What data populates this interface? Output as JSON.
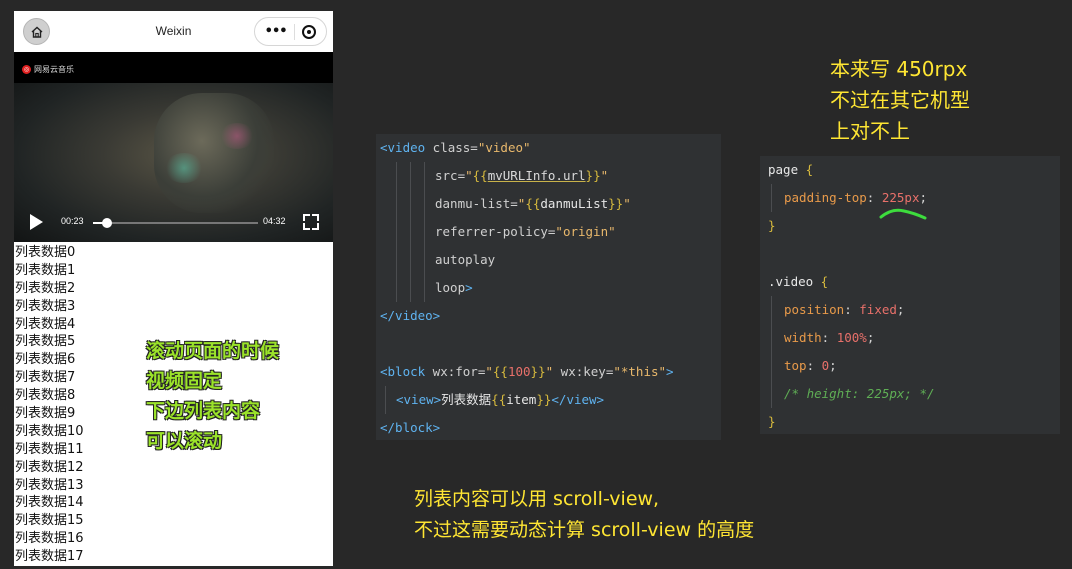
{
  "phone": {
    "nav_title": "Weixin",
    "capsule_menu": "•••",
    "video": {
      "brand": "网易云音乐",
      "current_time": "00:23",
      "total_time": "04:32",
      "progress_fraction": 0.085
    },
    "list_items": [
      "列表数据0",
      "列表数据1",
      "列表数据2",
      "列表数据3",
      "列表数据4",
      "列表数据5",
      "列表数据6",
      "列表数据7",
      "列表数据8",
      "列表数据9",
      "列表数据10",
      "列表数据11",
      "列表数据12",
      "列表数据13",
      "列表数据14",
      "列表数据15",
      "列表数据16",
      "列表数据17"
    ],
    "note": [
      "滚动页面的时候",
      "视频固定",
      "下边列表内容",
      "可以滚动"
    ]
  },
  "code_wxml": {
    "l1_tag": "<video",
    "l1_attr": " class=",
    "l1_val": "\"video\"",
    "l2_attr": "src=",
    "l2_q1": "\"",
    "l2_open": "{{",
    "l2_var": "mvURLInfo.url",
    "l2_close": "}}",
    "l2_q2": "\"",
    "l3_attr": "danmu-list=",
    "l3_q1": "\"",
    "l3_open": "{{",
    "l3_var": "danmuList",
    "l3_close": "}}",
    "l3_q2": "\"",
    "l4_attr": "referrer-policy=",
    "l4_val": "\"origin\"",
    "l5_attr": "autoplay",
    "l6_attr": "loop",
    "l6_tag": ">",
    "l7_tag": "</video>",
    "l9_tag": "<block",
    "l9_attr1": " wx:for=",
    "l9_q1": "\"",
    "l9_open": "{{",
    "l9_num": "100",
    "l9_close": "}}",
    "l9_q2": "\"",
    "l9_attr2": " wx:key=",
    "l9_val2": "\"*this\"",
    "l9_end": ">",
    "l10_tag1": "<view>",
    "l10_text": "列表数据",
    "l10_open": "{{",
    "l10_var": "item",
    "l10_close": "}}",
    "l10_tag2": "</view>",
    "l11_tag": "</block>"
  },
  "code_css": {
    "l1_sel": "page",
    "l1_brace": " {",
    "l2_prop": "padding-top",
    "l2_val": "225px",
    "l3_brace": "}",
    "l5_sel": ".video",
    "l5_brace": " {",
    "l6_prop": "position",
    "l6_val": "fixed",
    "l7_prop": "width",
    "l7_val": "100%",
    "l8_prop": "top",
    "l8_val": "0",
    "l9_comment": "/* height: 225px; */",
    "l10_brace": "}"
  },
  "annotations": {
    "top_right": [
      "本来写 450rpx",
      "不过在其它机型",
      "上对不上"
    ],
    "bottom": [
      "列表内容可以用 scroll-view,",
      "不过这需要动态计算 scroll-view 的高度"
    ]
  },
  "colors": {
    "background": "#282828",
    "code_bg": "#2f3133",
    "annotation_yellow": "#ffe633",
    "note_green": "#9be32a"
  }
}
